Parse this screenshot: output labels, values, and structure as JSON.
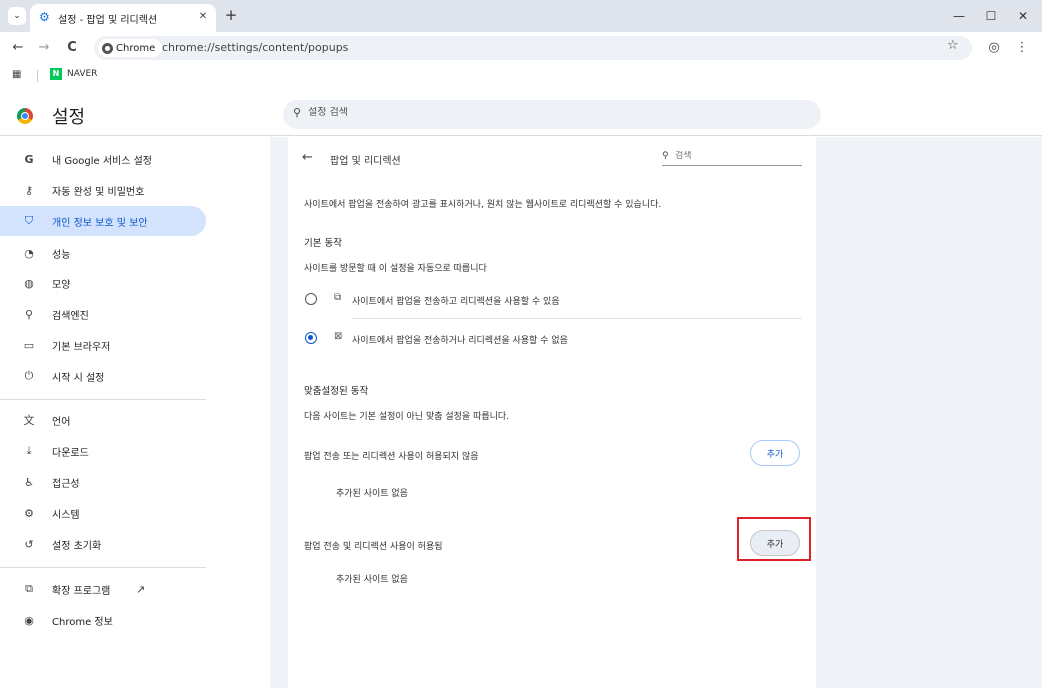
{
  "tabbar": {
    "menu_glyph": "⌄",
    "tab_title": "설정 - 팝업 및 리디렉션",
    "close_glyph": "✕",
    "newtab_glyph": "+",
    "window_controls": {
      "minimize": "—",
      "maximize": "☐",
      "close": "✕"
    }
  },
  "toolbar": {
    "back_glyph": "←",
    "forward_glyph": "→",
    "reload_glyph": "C",
    "chip_label": "Chrome",
    "url": "chrome://settings/content/popups",
    "star_glyph": "☆",
    "profile_glyph": "◎",
    "menu_glyph": "⋮"
  },
  "bookmarks": {
    "apps_glyph": "▦",
    "naver_logo": "N",
    "naver_label": "NAVER"
  },
  "header": {
    "title": "설정",
    "search_placeholder": "설정 검색"
  },
  "sidebar": {
    "items": [
      {
        "icon": "G",
        "label": "내 Google 서비스 설정"
      },
      {
        "icon": "⚷",
        "label": "자동 완성 및 비밀번호"
      },
      {
        "icon": "⛉",
        "label": "개인 정보 보호 및 보안"
      },
      {
        "icon": "◔",
        "label": "성능"
      },
      {
        "icon": "◍",
        "label": "모양"
      },
      {
        "icon": "⚲",
        "label": "검색엔진"
      },
      {
        "icon": "▭",
        "label": "기본 브라우저"
      },
      {
        "icon": "⏻",
        "label": "시작 시 설정"
      },
      {
        "icon": "文",
        "label": "언어"
      },
      {
        "icon": "⤓",
        "label": "다운로드"
      },
      {
        "icon": "♿",
        "label": "접근성"
      },
      {
        "icon": "⚙",
        "label": "시스템"
      },
      {
        "icon": "↺",
        "label": "설정 초기화"
      },
      {
        "icon": "⧉",
        "label": "확장 프로그램"
      },
      {
        "icon": "◉",
        "label": "Chrome 정보"
      }
    ],
    "external_glyph": "↗"
  },
  "content": {
    "back_glyph": "←",
    "title": "팝업 및 리디렉션",
    "search_placeholder": "검색",
    "description": "사이트에서 팝업을 전송하여 광고를 표시하거나, 원치 않는 웹사이트로 리디렉션할 수 있습니다.",
    "default_heading": "기본 동작",
    "default_desc": "사이트를 방문할 때 이 설정을 자동으로 따릅니다",
    "option_allow": "사이트에서 팝업을 전송하고 리디렉션을 사용할 수 있음",
    "option_block": "사이트에서 팝업을 전송하거나 리디렉션을 사용할 수 없음",
    "custom_heading": "맞춤설정된 동작",
    "custom_desc": "다음 사이트는 기본 설정이 아닌 맞춤 설정을 따릅니다.",
    "blocked_label": "팝업 전송 또는 리디렉션 사용이 허용되지 않음",
    "blocked_empty": "추가된 사이트 없음",
    "allowed_label": "팝업 전송 및 리디렉션 사용이 허용됨",
    "allowed_empty": "추가된 사이트 없음",
    "add_button": "추가"
  }
}
